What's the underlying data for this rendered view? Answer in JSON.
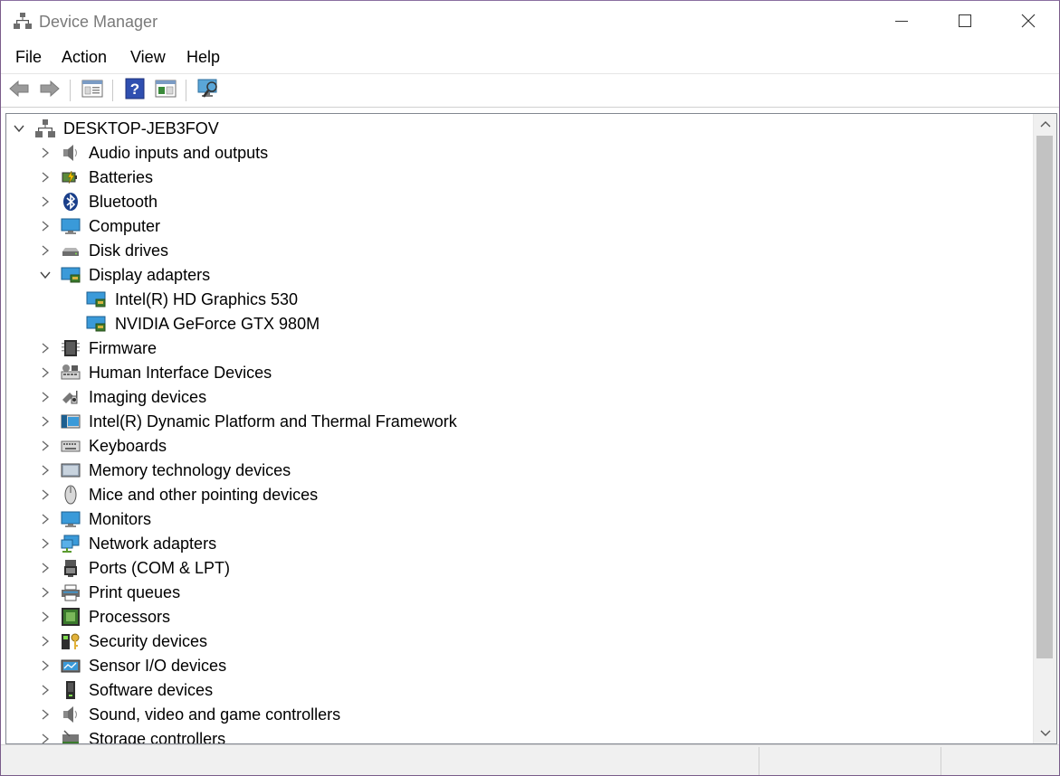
{
  "window": {
    "title": "Device Manager"
  },
  "icons": {
    "app": "device-manager-icon",
    "minimize": "minimize-icon",
    "maximize": "maximize-icon",
    "close": "close-icon"
  },
  "menu": [
    "File",
    "Action",
    "View",
    "Help"
  ],
  "toolbar": [
    "back-icon",
    "forward-icon",
    "properties-icon",
    "help-icon",
    "update-driver-icon",
    "scan-hardware-icon"
  ],
  "tree": {
    "root": "DESKTOP-JEB3FOV",
    "items": [
      {
        "label": "Audio inputs and outputs",
        "icon": "speaker-icon",
        "expanded": false
      },
      {
        "label": "Batteries",
        "icon": "battery-icon",
        "expanded": false
      },
      {
        "label": "Bluetooth",
        "icon": "bluetooth-icon",
        "expanded": false
      },
      {
        "label": "Computer",
        "icon": "computer-icon",
        "expanded": false
      },
      {
        "label": "Disk drives",
        "icon": "disk-drive-icon",
        "expanded": false
      },
      {
        "label": "Display adapters",
        "icon": "display-adapter-icon",
        "expanded": true,
        "children": [
          "Intel(R) HD Graphics 530",
          "NVIDIA GeForce GTX 980M"
        ]
      },
      {
        "label": "Firmware",
        "icon": "firmware-icon",
        "expanded": false
      },
      {
        "label": "Human Interface Devices",
        "icon": "hid-icon",
        "expanded": false
      },
      {
        "label": "Imaging devices",
        "icon": "camera-icon",
        "expanded": false
      },
      {
        "label": "Intel(R) Dynamic Platform and Thermal Framework",
        "icon": "thermal-framework-icon",
        "expanded": false
      },
      {
        "label": "Keyboards",
        "icon": "keyboard-icon",
        "expanded": false
      },
      {
        "label": "Memory technology devices",
        "icon": "memory-icon",
        "expanded": false
      },
      {
        "label": "Mice and other pointing devices",
        "icon": "mouse-icon",
        "expanded": false
      },
      {
        "label": "Monitors",
        "icon": "monitor-icon",
        "expanded": false
      },
      {
        "label": "Network adapters",
        "icon": "network-adapter-icon",
        "expanded": false
      },
      {
        "label": "Ports (COM & LPT)",
        "icon": "port-icon",
        "expanded": false
      },
      {
        "label": "Print queues",
        "icon": "printer-icon",
        "expanded": false
      },
      {
        "label": "Processors",
        "icon": "processor-icon",
        "expanded": false
      },
      {
        "label": "Security devices",
        "icon": "security-key-icon",
        "expanded": false
      },
      {
        "label": "Sensor I/O devices",
        "icon": "sensor-icon",
        "expanded": false
      },
      {
        "label": "Software devices",
        "icon": "software-device-icon",
        "expanded": false
      },
      {
        "label": "Sound, video and game controllers",
        "icon": "speaker-icon",
        "expanded": false
      },
      {
        "label": "Storage controllers",
        "icon": "storage-controller-icon",
        "expanded": false
      }
    ]
  }
}
